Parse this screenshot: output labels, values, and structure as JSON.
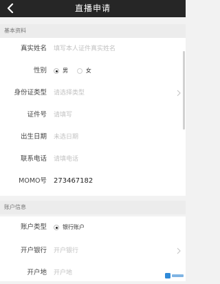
{
  "header": {
    "title": "直播申请"
  },
  "basic": {
    "section_title": "基本资料",
    "real_name": {
      "label": "真实姓名",
      "placeholder": "填写本人证件真实姓名"
    },
    "gender": {
      "label": "性别",
      "options": [
        {
          "label": "男",
          "selected": true
        },
        {
          "label": "女",
          "selected": false
        }
      ]
    },
    "id_type": {
      "label": "身份证类型",
      "placeholder": "请选择类型"
    },
    "id_number": {
      "label": "证件号",
      "placeholder": "请填写"
    },
    "birth_date": {
      "label": "出生日期",
      "placeholder": "未选日期"
    },
    "phone": {
      "label": "联系电话",
      "placeholder": "请填电话"
    },
    "momo": {
      "label": "MOMO号",
      "value": "273467182"
    }
  },
  "account": {
    "section_title": "账户信息",
    "account_type": {
      "label": "账户类型",
      "option": "银行账户",
      "selected": true
    },
    "bank": {
      "label": "开户银行",
      "placeholder": "开户银行"
    },
    "location": {
      "label": "开户地",
      "placeholder": "开户地"
    }
  }
}
